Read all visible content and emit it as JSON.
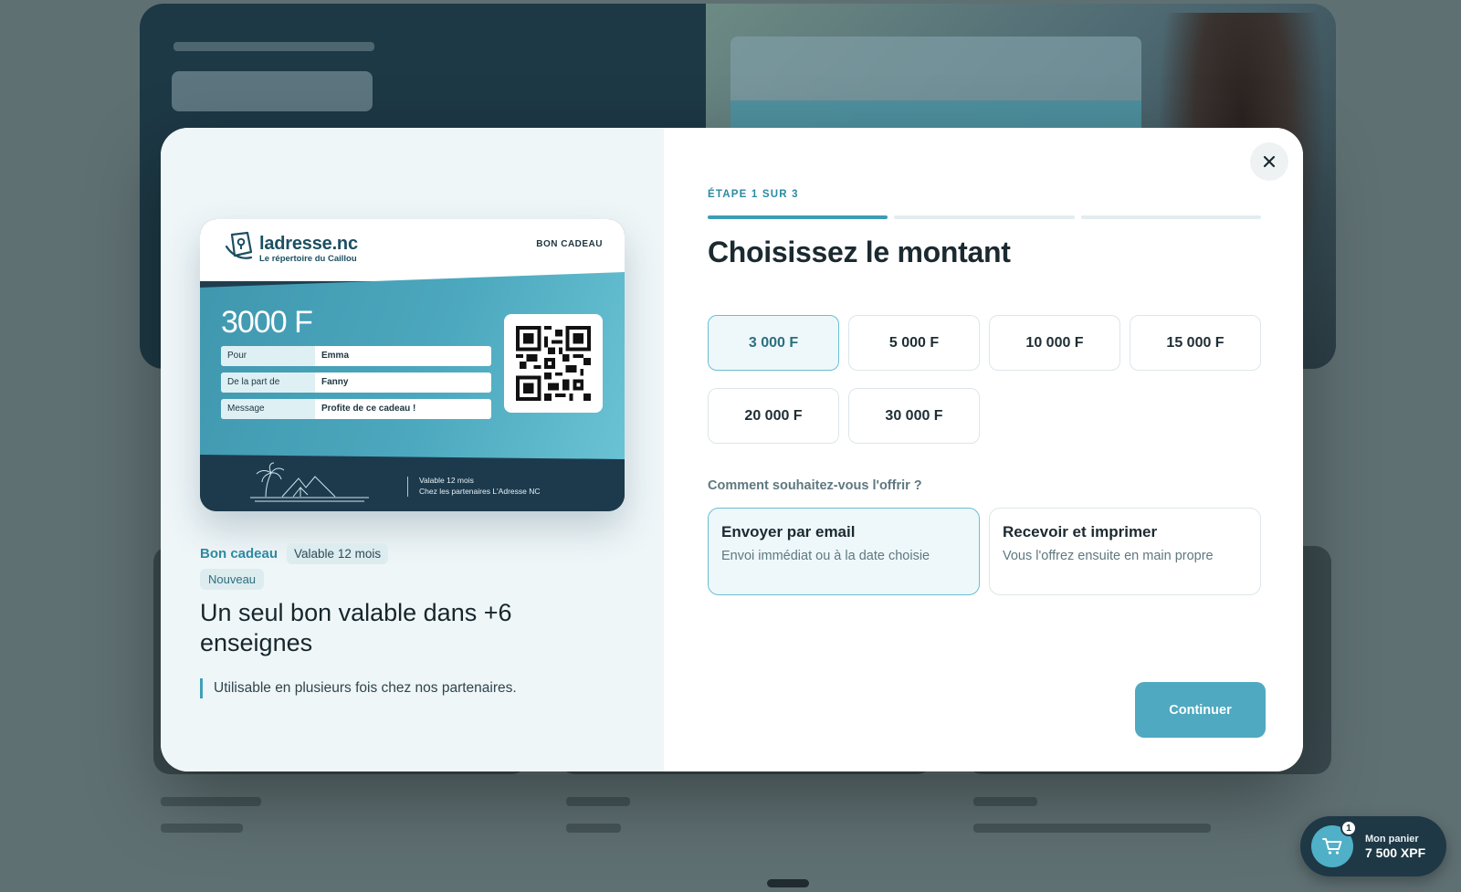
{
  "step": {
    "label": "ÉTAPE 1 SUR 3",
    "current": 1,
    "total": 3
  },
  "heading": "Choisissez le montant",
  "amounts": {
    "options": [
      "3 000 F",
      "5 000 F",
      "10 000 F",
      "15 000 F",
      "20 000 F",
      "30 000 F"
    ],
    "selected": "3 000 F"
  },
  "delivery": {
    "question": "Comment souhaitez-vous l'offrir ?",
    "options": [
      {
        "title": "Envoyer par email",
        "subtitle": "Envoi immédiat ou à la date choisie",
        "selected": true
      },
      {
        "title": "Recevoir et imprimer",
        "subtitle": "Vous l'offrez ensuite en main propre",
        "selected": false
      }
    ]
  },
  "continue_label": "Continuer",
  "gift_card": {
    "brand_name": "ladresse.nc",
    "brand_tagline": "Le répertoire du Caillou",
    "card_label": "BON CADEAU",
    "amount": "3000 F",
    "fields": [
      {
        "key": "Pour",
        "value": "Emma"
      },
      {
        "key": "De la part de",
        "value": "Fanny"
      },
      {
        "key": "Message",
        "value": "Profite de ce cadeau !"
      }
    ],
    "validity_line1": "Valable 12 mois",
    "validity_line2": "Chez les partenaires L'Adresse NC"
  },
  "product": {
    "kind": "Bon cadeau",
    "validity_chip": "Valable 12 mois",
    "new_badge": "Nouveau",
    "title": "Un seul bon valable dans +6 enseignes",
    "description": "Utilisable en plusieurs fois chez nos partenaires."
  },
  "cart": {
    "count": "1",
    "label": "Mon panier",
    "total": "7 500 XPF"
  },
  "colors": {
    "accent": "#4fa9c0",
    "accent_dark": "#2c8aa2",
    "navy": "#1f3845"
  },
  "icons": [
    "close-icon",
    "cart-icon",
    "logo-icon",
    "qr-code",
    "island-illustration"
  ]
}
